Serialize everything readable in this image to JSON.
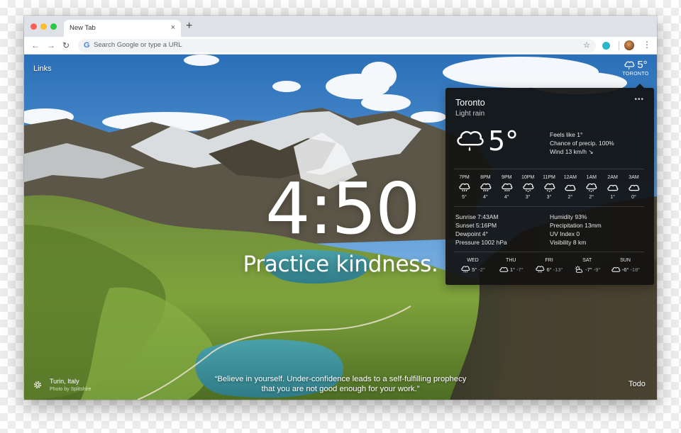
{
  "browser": {
    "tab_title": "New Tab",
    "tab_close": "×",
    "new_tab": "+",
    "omnibox_placeholder": "Search Google or type a URL",
    "omnibox_icon": "G",
    "star": "☆",
    "menu": "⋮",
    "back": "←",
    "forward": "→",
    "reload": "↻"
  },
  "newtab": {
    "links_label": "Links",
    "clock": "4:50",
    "mantra": "Practice kindness.",
    "location": "Turin, Italy",
    "photo_credit": "Photo by Splitshire",
    "quote": "“Believe in yourself. Under-confidence leads to a self-fulfilling prophecy that you are not good enough for your work.”",
    "todo_label": "Todo"
  },
  "weather_mini": {
    "temp": "5°",
    "city": "TORONTO"
  },
  "weather": {
    "city": "Toronto",
    "condition": "Light rain",
    "more": "•••",
    "temp": "5°",
    "details": [
      "Feels like 1°",
      "Chance of precip. 100%",
      "Wind 13 km/h ↘"
    ],
    "hourly": [
      {
        "time": "7PM",
        "temp": "5°",
        "icon": "rain-cloud-icon"
      },
      {
        "time": "8PM",
        "temp": "4°",
        "icon": "rain-cloud-icon"
      },
      {
        "time": "9PM",
        "temp": "4°",
        "icon": "rain-cloud-icon"
      },
      {
        "time": "10PM",
        "temp": "3°",
        "icon": "snow-cloud-icon"
      },
      {
        "time": "11PM",
        "temp": "3°",
        "icon": "snow-cloud-icon"
      },
      {
        "time": "12AM",
        "temp": "2°",
        "icon": "cloud-icon"
      },
      {
        "time": "1AM",
        "temp": "2°",
        "icon": "snow-cloud-icon"
      },
      {
        "time": "2AM",
        "temp": "1°",
        "icon": "cloud-icon"
      },
      {
        "time": "3AM",
        "temp": "0°",
        "icon": "cloud-icon"
      }
    ],
    "metrics_left": [
      "Sunrise 7:43AM",
      "Sunset 5:16PM",
      "Dewpoint 4°",
      "Pressure 1002 hPa"
    ],
    "metrics_right": [
      "Humidity 93%",
      "Precipitation 13mm",
      "UV Index 0",
      "Visibility 8 km"
    ],
    "daily": [
      {
        "day": "WED",
        "high": "5°",
        "low": "-2°",
        "icon": "rain-cloud-icon"
      },
      {
        "day": "THU",
        "high": "1°",
        "low": "-7°",
        "icon": "cloud-icon"
      },
      {
        "day": "FRI",
        "high": "6°",
        "low": "-13°",
        "icon": "rain-cloud-icon"
      },
      {
        "day": "SAT",
        "high": "-7°",
        "low": "-9°",
        "icon": "partly-sunny-icon"
      },
      {
        "day": "SUN",
        "high": "-6°",
        "low": "-18°",
        "icon": "cloud-icon"
      }
    ]
  }
}
